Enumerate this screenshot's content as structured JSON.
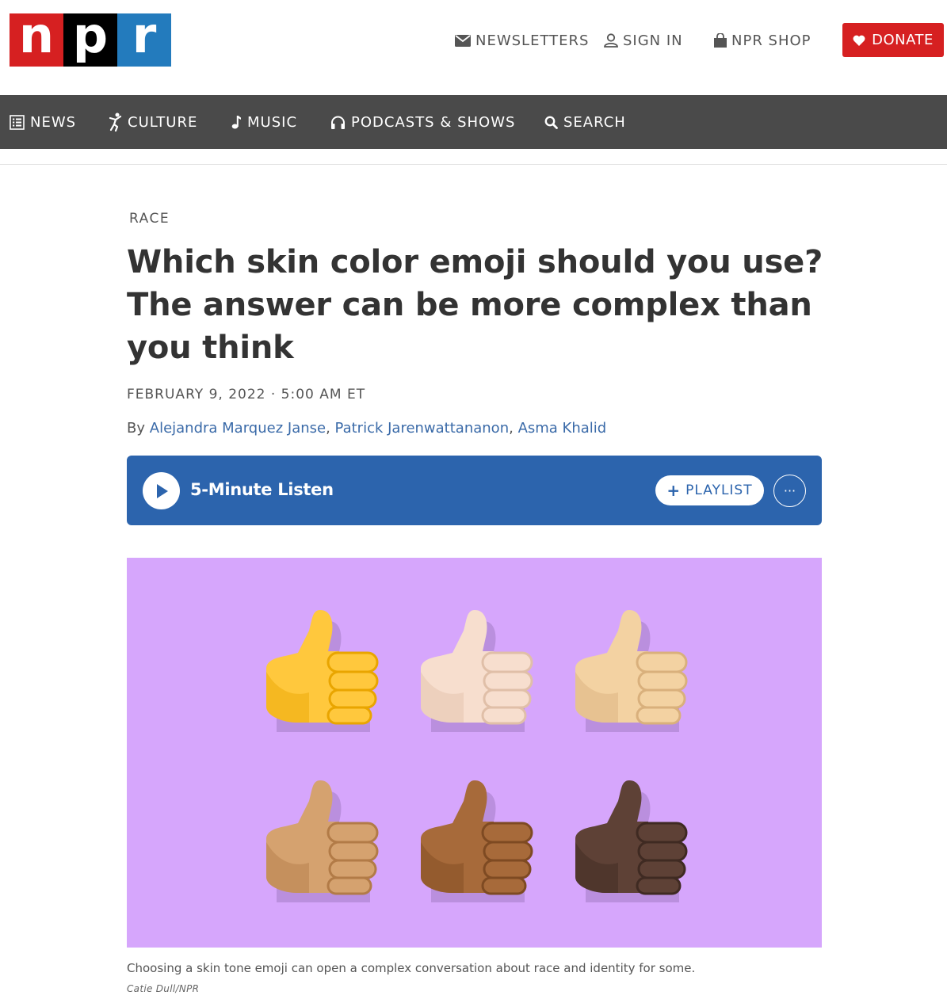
{
  "logo": {
    "letters": [
      "n",
      "p",
      "r"
    ]
  },
  "utility": {
    "newsletters": "NEWSLETTERS",
    "sign_in": "SIGN IN",
    "shop": "NPR SHOP",
    "donate": "DONATE"
  },
  "nav": {
    "items": [
      {
        "label": "NEWS",
        "icon": "news-icon"
      },
      {
        "label": "CULTURE",
        "icon": "culture-icon"
      },
      {
        "label": "MUSIC",
        "icon": "music-note-icon"
      },
      {
        "label": "PODCASTS & SHOWS",
        "icon": "headphones-icon"
      },
      {
        "label": "SEARCH",
        "icon": "search-icon"
      }
    ]
  },
  "article": {
    "slug": "RACE",
    "headline": "Which skin color emoji should you use? The answer can be more complex than you think",
    "date": "FEBRUARY 9, 2022 · 5:00 AM ET",
    "by": "By",
    "authors": [
      "Alejandra Marquez Janse",
      "Patrick Jarenwattananon",
      "Asma Khalid"
    ],
    "sep": ", "
  },
  "player": {
    "listen": "5-Minute Listen",
    "playlist": "PLAYLIST",
    "playlist_plus": "+",
    "more": "···"
  },
  "image": {
    "background": "#d6a6fc",
    "thumb_tones": [
      {
        "base": "#ffc83d",
        "shade": "#e9a500"
      },
      {
        "base": "#f7dece",
        "shade": "#e0bfa8"
      },
      {
        "base": "#f3d2a2",
        "shade": "#d9b07c"
      },
      {
        "base": "#d5a26f",
        "shade": "#b27b47"
      },
      {
        "base": "#a76a3a",
        "shade": "#7e4a22"
      },
      {
        "base": "#5e4136",
        "shade": "#3f2a22"
      }
    ],
    "caption": "Choosing a skin tone emoji can open a complex conversation about race and identity for some.",
    "credit": "Catie Dull/NPR"
  },
  "colors": {
    "brand_red": "#d62021",
    "brand_blue": "#237bbd",
    "nav_bg": "#4a4a4a",
    "player_bg": "#2c64ad",
    "link": "#3a6aa8"
  }
}
